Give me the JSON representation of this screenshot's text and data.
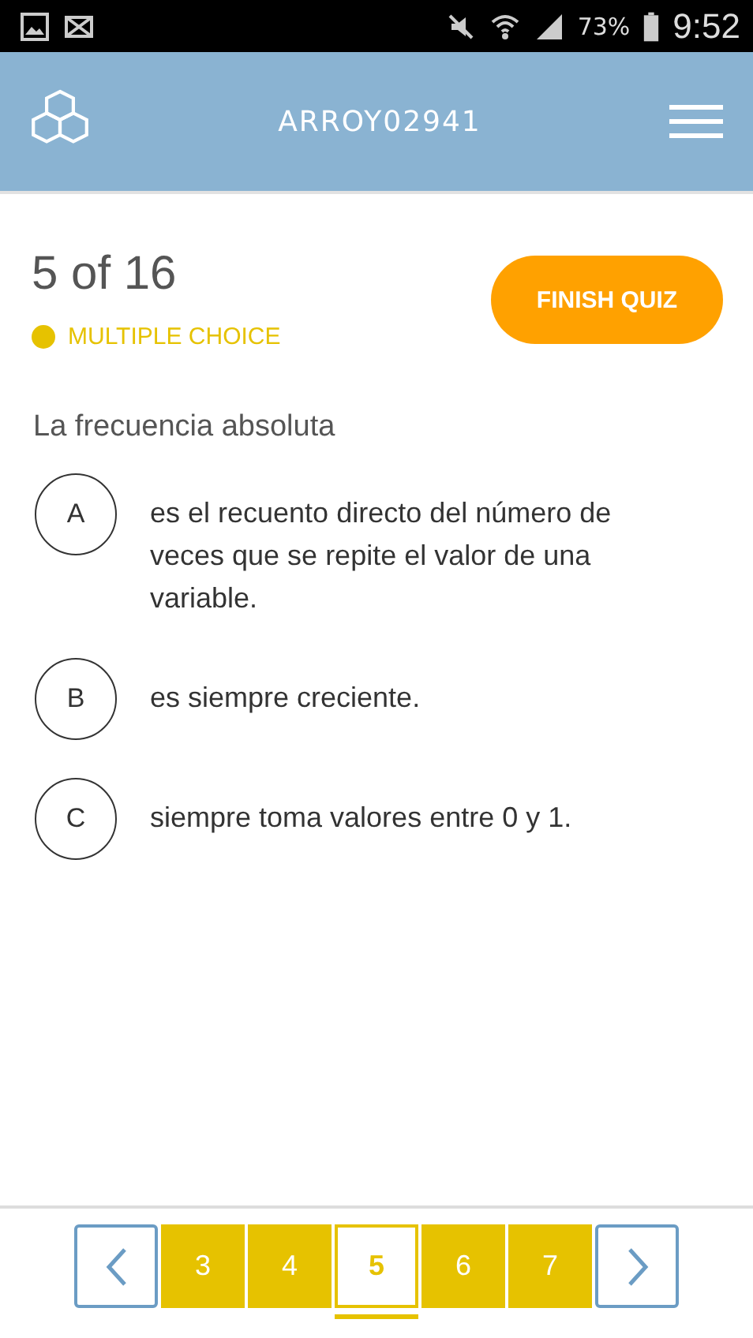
{
  "status_bar": {
    "battery": "73%",
    "time": "9:52"
  },
  "header": {
    "title": "ARROY02941"
  },
  "quiz": {
    "progress": "5 of 16",
    "type": "MULTIPLE CHOICE",
    "finish": "FINISH QUIZ"
  },
  "question": "La frecuencia absoluta",
  "options": [
    {
      "letter": "A",
      "text": "es el recuento directo del número de veces que se repite el valor de una variable."
    },
    {
      "letter": "B",
      "text": "es siempre creciente."
    },
    {
      "letter": "C",
      "text": "siempre toma valores entre 0 y 1."
    }
  ],
  "pages": [
    {
      "label": "3",
      "selected": false
    },
    {
      "label": "4",
      "selected": false
    },
    {
      "label": "5",
      "selected": true
    },
    {
      "label": "6",
      "selected": false
    },
    {
      "label": "7",
      "selected": false
    }
  ]
}
